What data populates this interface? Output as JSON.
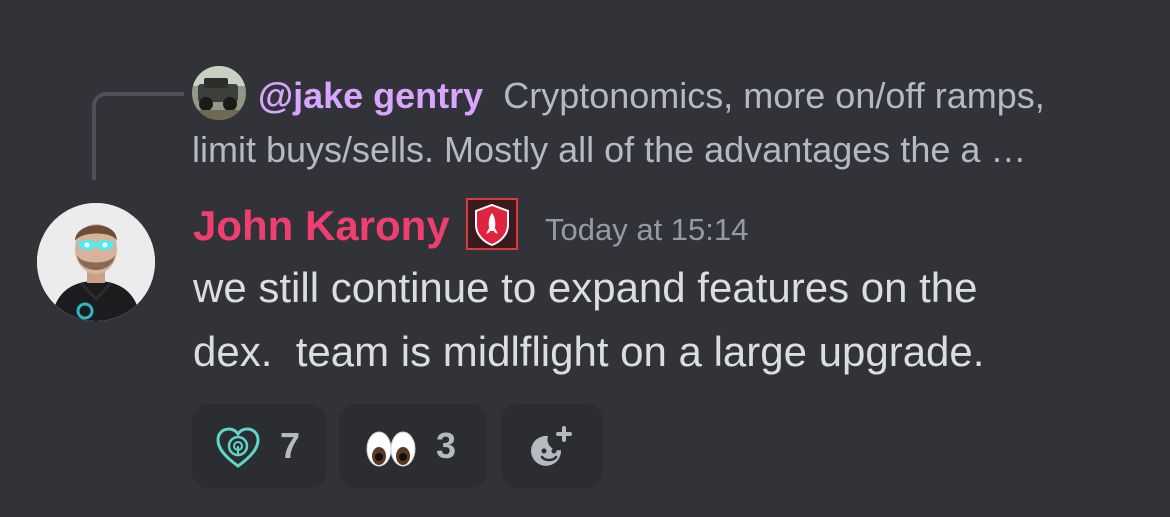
{
  "reply": {
    "mention": "@jake gentry",
    "text_line1": "Cryptonomics, more on/off ramps,",
    "text_line2": "limit buys/sells. Mostly all of the advantages the a …",
    "avatar_icon": "user-avatar-truck-photo"
  },
  "message": {
    "author": "John Karony",
    "author_color": "#ee3f70",
    "role_badge_icon": "rocket-shield-icon",
    "timestamp": "Today at 15:14",
    "content_line1": "we still continue to expand features on the",
    "content_line2": "dex.  team is midlflight on a large upgrade.",
    "avatar_icon": "user-avatar-photo"
  },
  "reactions": [
    {
      "emoji_icon": "teal-heart-logo-icon",
      "count": "7"
    },
    {
      "emoji_icon": "eyes-emoji-icon",
      "count": "3"
    },
    {
      "emoji_icon": "add-reaction-icon",
      "count": ""
    }
  ],
  "colors": {
    "background": "#313338",
    "mention": "#d9a6ff",
    "reaction_bg": "#2b2d31"
  }
}
